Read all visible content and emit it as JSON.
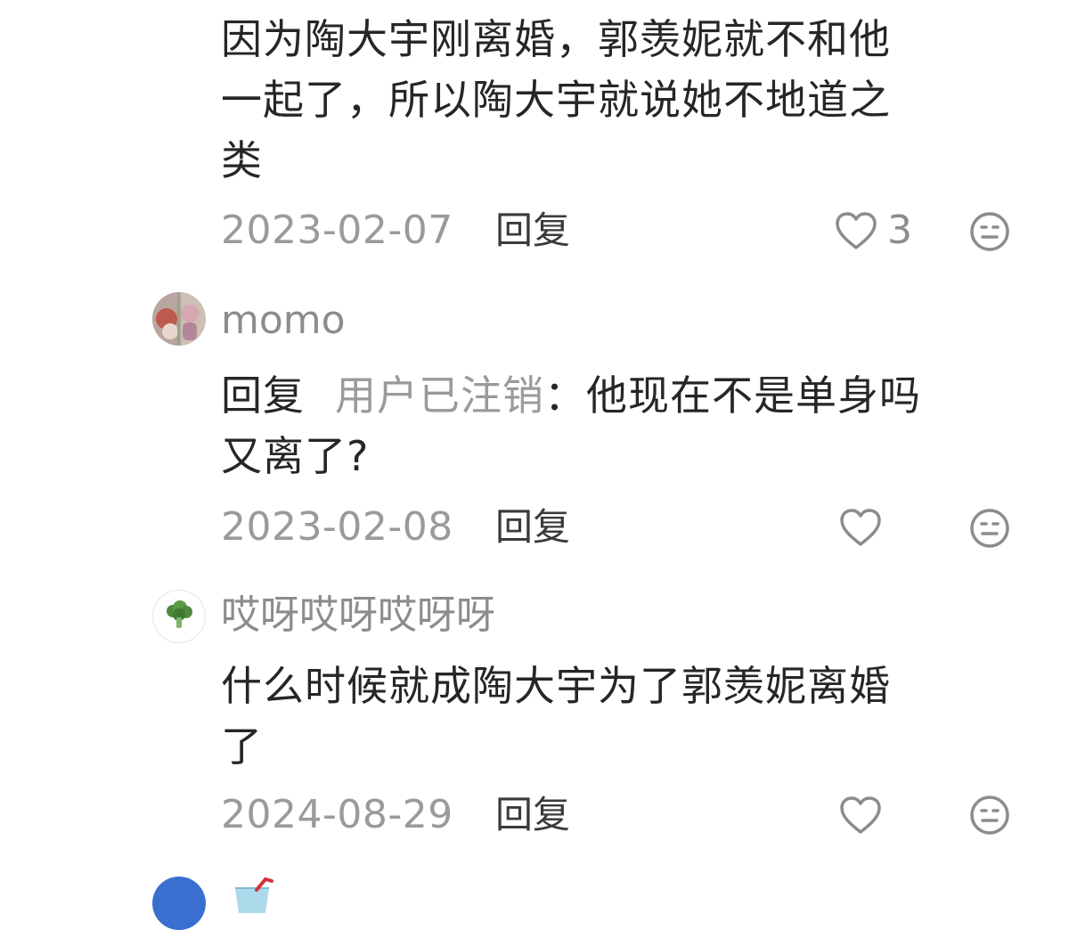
{
  "comments": [
    {
      "text_lines": [
        "因为陶大宇刚离婚，郭羡妮就不和他",
        "一起了，所以陶大宇就说她不地道之",
        "类"
      ],
      "date": "2023-02-07",
      "reply_label": "回复",
      "like_count": "3"
    },
    {
      "username": "momo",
      "reply_prefix": "回复",
      "reply_target": "用户已注销",
      "reply_colon": "：",
      "text_line1_rest": "他现在不是单身吗",
      "text_line2": "又离了?",
      "date": "2023-02-08",
      "reply_label": "回复"
    },
    {
      "username": "哎呀哎呀哎呀呀",
      "text_lines": [
        "什么时候就成陶大宇为了郭羡妮离婚",
        "了"
      ],
      "date": "2024-08-29",
      "reply_label": "回复"
    },
    {
      "username_icon": "cup-with-straw-icon"
    }
  ],
  "colors": {
    "text": "#262626",
    "muted": "#9a9a9a",
    "icon": "#8c8c8c",
    "avatar_blue": "#3a6fd0"
  },
  "icons": {
    "like": "heart-outline-icon",
    "emoji": "neutral-face-icon",
    "broccoli_avatar": "broccoli-icon"
  }
}
